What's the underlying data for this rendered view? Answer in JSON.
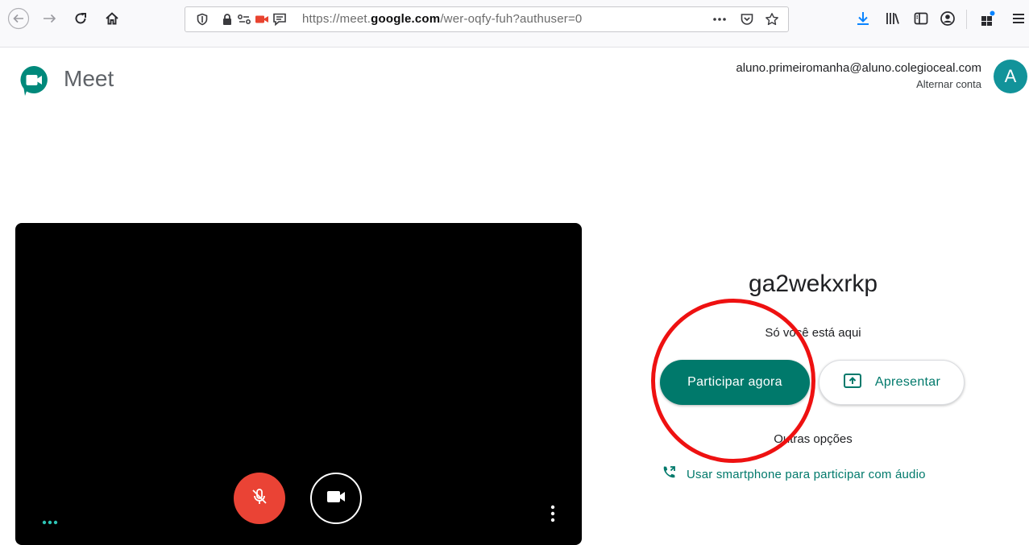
{
  "browser": {
    "url_prefix": "https://meet.",
    "url_domain": "google.com",
    "url_path": "/wer-oqfy-fuh?authuser=0",
    "icons": [
      "back-icon",
      "forward-icon",
      "reload-icon",
      "home-icon",
      "shield-icon",
      "lock-icon",
      "permissions-icon",
      "camera-indicator-icon",
      "chat-icon",
      "more-icon",
      "pocket-icon",
      "bookmark-star-icon",
      "download-icon",
      "library-icon",
      "sidebar-icon",
      "account-icon",
      "extension-icon",
      "menu-icon"
    ]
  },
  "header": {
    "app_name": "Meet",
    "account_email": "aluno.primeiromanha@aluno.colegioceal.com",
    "switch_account": "Alternar conta",
    "avatar_letter": "A"
  },
  "join_panel": {
    "meeting_code": "ga2wekxrkp",
    "status": "Só você está aqui",
    "join_label": "Participar agora",
    "present_label": "Apresentar",
    "other_options": "Outras opções",
    "phone_label": "Usar smartphone para participar com áudio"
  },
  "colors": {
    "accent": "#00796b",
    "mic_off": "#ea4335",
    "annotation": "#ee1111"
  }
}
